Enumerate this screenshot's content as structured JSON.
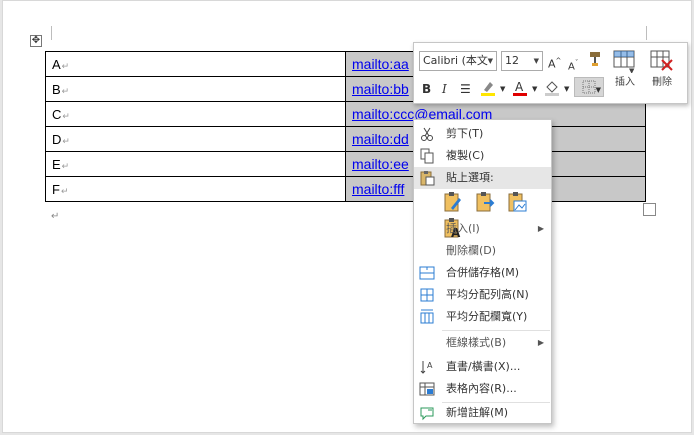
{
  "table": {
    "rows": [
      {
        "label": "A",
        "mail": "mailto:aa"
      },
      {
        "label": "B",
        "mail": "mailto:bb"
      },
      {
        "label": "C",
        "mail": "mailto:ccc@email.com"
      },
      {
        "label": "D",
        "mail": "mailto:dd"
      },
      {
        "label": "E",
        "mail": "mailto:ee"
      },
      {
        "label": "F",
        "mail": "mailto:fff"
      }
    ]
  },
  "mini_toolbar": {
    "font": "Calibri (本文",
    "size": "12",
    "insert_label": "插入",
    "delete_label": "刪除"
  },
  "menu": {
    "cut": "剪下(T)",
    "copy": "複製(C)",
    "paste_options": "貼上選項:",
    "insert": "插入(I)",
    "delete_column": "刪除欄(D)",
    "merge_cells": "合併儲存格(M)",
    "distribute_rows": "平均分配列高(N)",
    "distribute_columns": "平均分配欄寬(Y)",
    "border_styles": "框線樣式(B)",
    "text_direction": "直書/橫書(X)...",
    "table_properties": "表格內容(R)...",
    "new_comment": "新增註解(M)"
  },
  "colors": {
    "highlight": "#ffe600",
    "font_color": "#e00000",
    "link": "#0000ee",
    "cell_shade": "#c8c8c8"
  }
}
